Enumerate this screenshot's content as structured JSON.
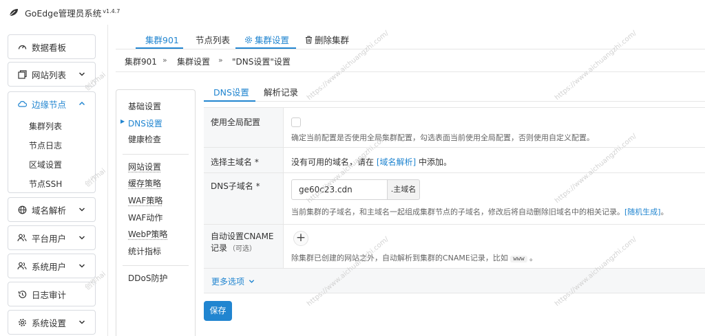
{
  "app": {
    "title": "GoEdge管理员系统",
    "version": "v1.4.7"
  },
  "sidebar": {
    "dashboard": "数据看板",
    "websites": "网站列表",
    "edge_nodes": "边缘节点",
    "edge_sub": [
      "集群列表",
      "节点日志",
      "区域设置",
      "节点SSH"
    ],
    "dns": "域名解析",
    "platform_users": "平台用户",
    "system_users": "系统用户",
    "audit_logs": "日志审计",
    "settings": "系统设置"
  },
  "tabs": {
    "cluster": "集群901",
    "nodes": "节点列表",
    "cluster_settings": "集群设置",
    "delete_cluster": "删除集群"
  },
  "breadcrumb": [
    "集群901",
    "集群设置",
    "\"DNS设置\"设置"
  ],
  "breadcrumb_sep": "»",
  "second_menu": {
    "basic": "基础设置",
    "dns": "DNS设置",
    "health": "健康检查",
    "website": "网站设置",
    "cache": "缓存策略",
    "waf_policy": "WAF策略",
    "waf_action": "WAF动作",
    "webp": "WebP策略",
    "metrics": "统计指标",
    "ddos": "DDoS防护"
  },
  "subtabs": {
    "dns": "DNS设置",
    "records": "解析记录"
  },
  "form": {
    "use_global": {
      "label": "使用全局配置",
      "comment": "确定当前配置是否使用全局集群配置，勾选表面当前使用全局配置，否则使用自定义配置。"
    },
    "main_domain": {
      "label": "选择主域名 *",
      "text_before": "没有可用的域名，请在",
      "link": "[域名解析]",
      "text_after": "中添加。"
    },
    "subdomain": {
      "label": "DNS子域名 *",
      "value": "ge60c23.cdn",
      "suffix": ".主域名",
      "comment_before": "当前集群的子域名，和主域名一起组成集群节点的子域名，修改后将自动删除旧域名中的相关记录。",
      "link": "[随机生成]",
      "comment_after": "。"
    },
    "cname": {
      "label": "自动设置CNAME记录",
      "optional": "（可选）",
      "plus": "+",
      "comment_before": "除集群已创建的网站之外，自动解析到集群的CNAME记录，比如",
      "code": "www",
      "comment_after": "。"
    },
    "more_options": "更多选项"
  },
  "save_button": "保存",
  "watermark": [
    "创作hai",
    "https://www.aichuangzhi.com/"
  ],
  "colors": {
    "accent": "#2185d0",
    "border": "#e6e6e6",
    "label_bg": "#f6f7f8"
  }
}
